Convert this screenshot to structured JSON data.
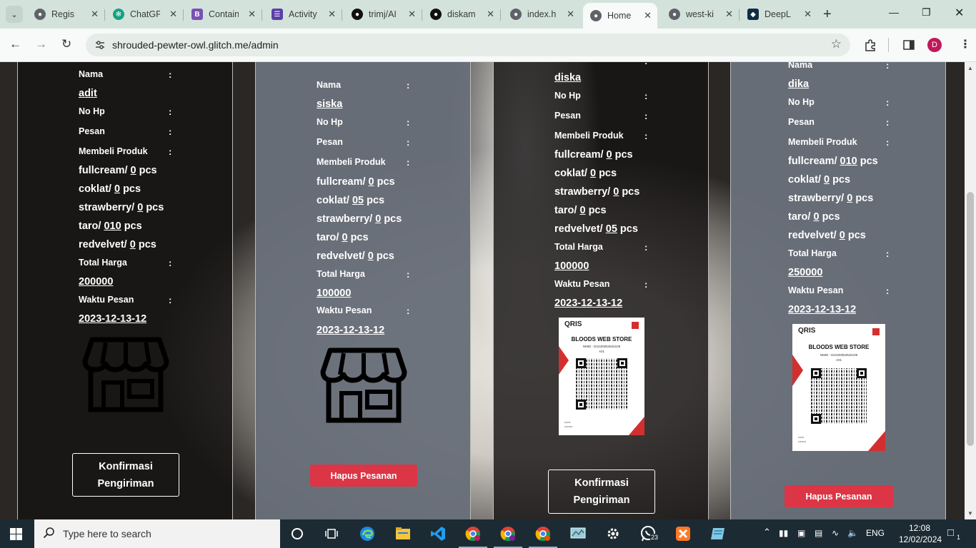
{
  "browser": {
    "tabs": [
      {
        "title": "Regis",
        "favicon": "globe-icon",
        "color": "#5f6368"
      },
      {
        "title": "ChatGP",
        "favicon": "openai-icon",
        "color": "#10a37f"
      },
      {
        "title": "Contain",
        "favicon": "bootstrap-icon",
        "color": "#7952b3"
      },
      {
        "title": "Activity",
        "favicon": "activity-icon",
        "color": "#5b3fa8"
      },
      {
        "title": "trimj/AI",
        "favicon": "github-icon",
        "color": "#111111"
      },
      {
        "title": "diskam",
        "favicon": "github-icon",
        "color": "#111111"
      },
      {
        "title": "index.h",
        "favicon": "globe-icon",
        "color": "#5f6368"
      },
      {
        "title": "Home",
        "favicon": "globe-icon",
        "color": "#5f6368",
        "active": true
      },
      {
        "title": "west-ki",
        "favicon": "globe-icon",
        "color": "#5f6368"
      },
      {
        "title": "DeepL",
        "favicon": "deepl-icon",
        "color": "#0f2b46"
      }
    ],
    "url": "shrouded-pewter-owl.glitch.me/admin",
    "profile_initial": "D"
  },
  "labels": {
    "nama": "Nama",
    "nohp": "No Hp",
    "pesan": "Pesan",
    "membeli": "Membeli Produk",
    "total": "Total Harga",
    "waktu": "Waktu Pesan",
    "colon": ":",
    "pcs": "pcs"
  },
  "products": [
    "fullcream/",
    "coklat/",
    "strawberry/",
    "taro/",
    "redvelvet/"
  ],
  "orders": [
    {
      "nama": "adit",
      "qty": [
        "0",
        "0",
        "0",
        "010",
        "0"
      ],
      "total": "200000",
      "waktu": "2023-12-13-12",
      "image": "store-icon",
      "action": "Konfirmasi Pengiriman"
    },
    {
      "nama": "siska",
      "qty": [
        "0",
        "05",
        "0",
        "0",
        "0"
      ],
      "total": "100000",
      "waktu": "2023-12-13-12",
      "image": "store-icon",
      "action": "Hapus Pesanan"
    },
    {
      "nama": "diska",
      "qty": [
        "0",
        "0",
        "0",
        "0",
        "05"
      ],
      "total": "100000",
      "waktu": "2023-12-13-12",
      "image": "qris-code",
      "action": "Konfirmasi Pengiriman"
    },
    {
      "nama": "dika",
      "qty": [
        "010",
        "0",
        "0",
        "0",
        "0"
      ],
      "total": "250000",
      "waktu": "2023-12-13-12",
      "image": "qris-code",
      "action": "Hapus Pesanan"
    }
  ],
  "qris": {
    "brand": "QRIS",
    "store_name": "BLOODS WEB STORE",
    "nmid": "NMID : ID1020054534109",
    "code": "A01"
  },
  "taskbar": {
    "search_placeholder": "Type here to search",
    "language": "ENG",
    "time": "12:08",
    "date": "12/02/2024",
    "whatsapp_badge": "23",
    "notif_count": "1"
  }
}
